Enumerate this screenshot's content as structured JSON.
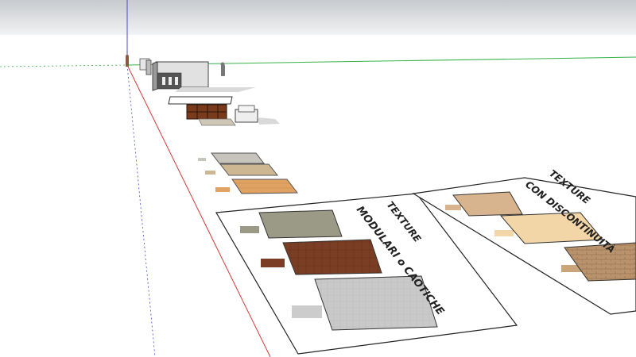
{
  "app": "SketchUp viewport",
  "colors": {
    "sky_top": "#c9ccd0",
    "sky_bottom": "#f4f5f6",
    "ground": "#ffffff",
    "axis_red": "#d43a3a",
    "axis_green": "#38b24a",
    "axis_blue": "#4a4acb"
  },
  "panel_modular": {
    "title_line1": "TEXTURE",
    "title_line2": "MODULARI o CAOTICHE",
    "swatches": [
      {
        "name": "gray-beige",
        "color": "#9b9a86"
      },
      {
        "name": "brown-tile",
        "color": "#7a3e25"
      },
      {
        "name": "light-gray",
        "color": "#c9c9c9"
      }
    ]
  },
  "panel_continuous": {
    "title_line1": "TEXTURE",
    "title_line2": "CON DISCONTINUITÀ",
    "swatches": [
      {
        "name": "tan",
        "color": "#d8b48e"
      },
      {
        "name": "cream",
        "color": "#f3d6a7"
      },
      {
        "name": "wood-parquet",
        "color": "#b9936b"
      }
    ]
  },
  "floor_samples": [
    {
      "name": "gray-tile",
      "color": "#c7c3bd"
    },
    {
      "name": "beige-tile",
      "color": "#cdb792"
    },
    {
      "name": "orange-parquet",
      "color": "#e0a262"
    }
  ]
}
